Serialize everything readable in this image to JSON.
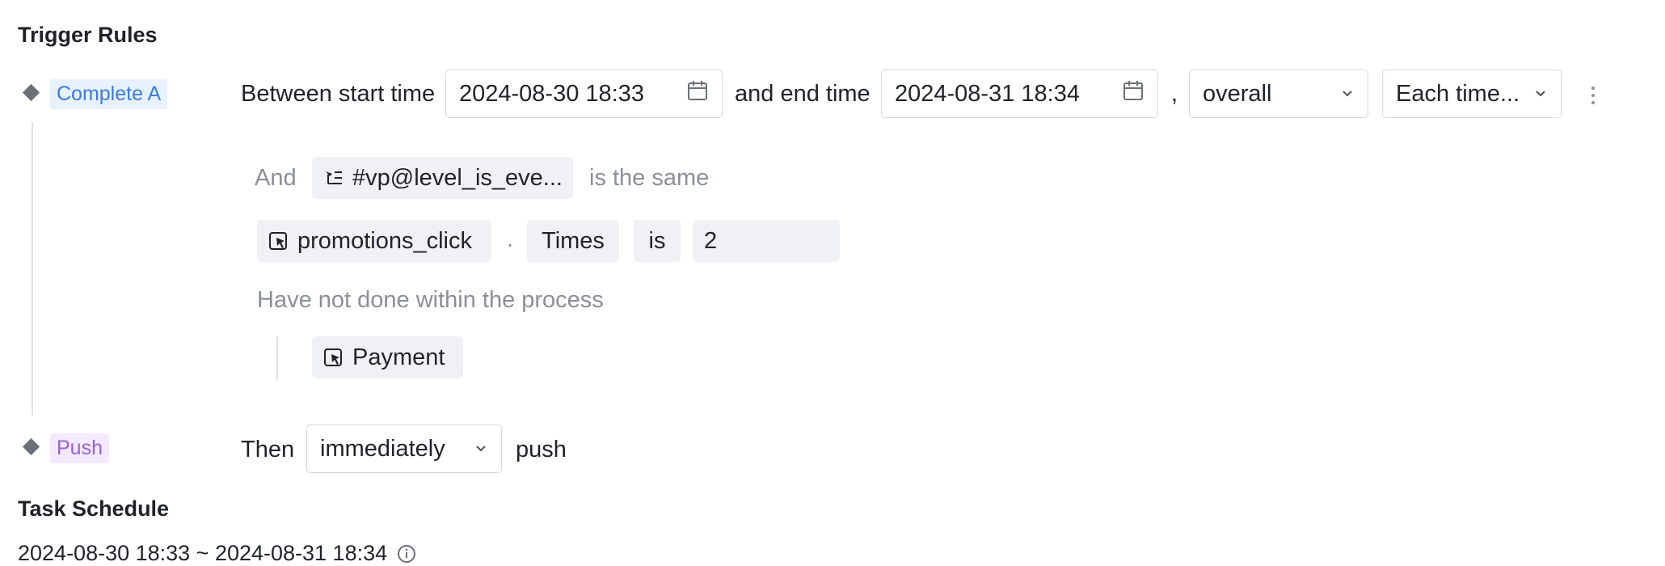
{
  "trigger_rules": {
    "title": "Trigger Rules",
    "complete_tag": "Complete A",
    "between_label": "Between start time",
    "start_time": "2024-08-30 18:33",
    "end_label": "and end time",
    "end_time": "2024-08-31 18:34",
    "comma": ",",
    "scope_select": "overall",
    "frequency_select": "Each time...",
    "and_label": "And",
    "property_chip": "#vp@level_is_eve...",
    "same_label": "is the same",
    "event_chip": "promotions_click",
    "dot": ".",
    "metric_chip": "Times",
    "operator_chip": "is",
    "value_input": "2",
    "not_done_label": "Have not done within the process",
    "excluded_event": "Payment",
    "push_tag": "Push",
    "then_label": "Then",
    "timing_select": "immediately",
    "push_label": "push"
  },
  "task_schedule": {
    "title": "Task Schedule",
    "range": "2024-08-30 18:33 ~ 2024-08-31 18:34"
  },
  "icons": {
    "calendar": "calendar-icon",
    "chevron": "chevron-down-icon",
    "more": "more-vertical-icon",
    "event": "event-cursor-icon",
    "property": "property-tree-icon",
    "info": "info-icon"
  },
  "colors": {
    "complete_tag_bg": "#e8f1ff",
    "complete_tag_text": "#3a7ce0",
    "push_tag_bg": "#f3eafd",
    "push_tag_text": "#9b5fd6",
    "chip_bg": "#f0f1f5"
  }
}
